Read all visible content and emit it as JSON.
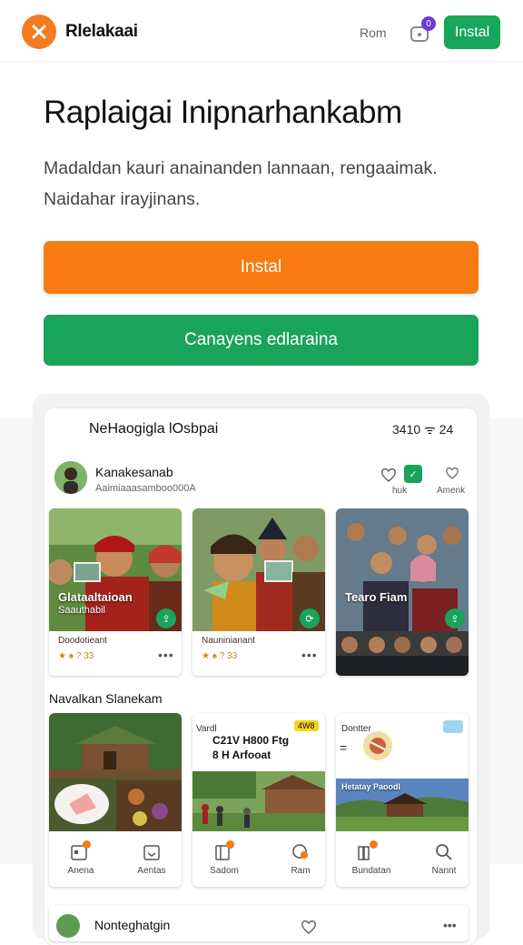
{
  "header": {
    "app_name": "Rlelakaai",
    "login_label": "Rom",
    "notification_count": "0",
    "install_label": "Instal",
    "colors": {
      "brand_orange": "#f47b20",
      "accent_purple": "#6b3ad6",
      "install_green": "#17a65a"
    }
  },
  "hero": {
    "title": "Raplaigai Inipnarhankabm",
    "subtitle": "Madaldan kauri anainanden lannaan, rengaaimak. Naidahar irayjinans.",
    "primary_button": "Instal",
    "secondary_button": "Canayens edlaraina"
  },
  "preview": {
    "title": "NeHaogigla lOsbpai",
    "status": "3410 ᯤ 24",
    "profile": {
      "name": "Kanakesanab",
      "subtitle": "Aaimiaaasamboo000A",
      "action1_label": "huk",
      "action2_label": "Amenk"
    },
    "cards": [
      {
        "caption": "Glataaltaioan",
        "caption_sub": "Saauthabil",
        "meta": "Doodotieant",
        "stars": "★ ♠ ? 33",
        "more": "•••"
      },
      {
        "caption": "",
        "caption_sub": "",
        "meta": "Nauninianant",
        "stars": "★ ♠ ? 33",
        "more": "•••"
      },
      {
        "caption": "Tearo Fiam",
        "caption_sub": "",
        "meta": "",
        "stars": "",
        "more": ""
      }
    ],
    "section_title": "Navalkan Slanekam",
    "tiles": [
      {
        "label_left": "Anena",
        "label_right": "Aentas"
      },
      {
        "header": "Vardl",
        "headline": "C21V H800 Ftg\n8 H Arfooat",
        "tag": "4W8",
        "label_left": "Sadom",
        "label_right": "Ram"
      },
      {
        "header": "Dontter",
        "caption": "Hetatay Paoodl",
        "label_left": "Bundatan",
        "label_right": "Nannt"
      }
    ],
    "bottom_card_name": "Nonteghatgin"
  }
}
